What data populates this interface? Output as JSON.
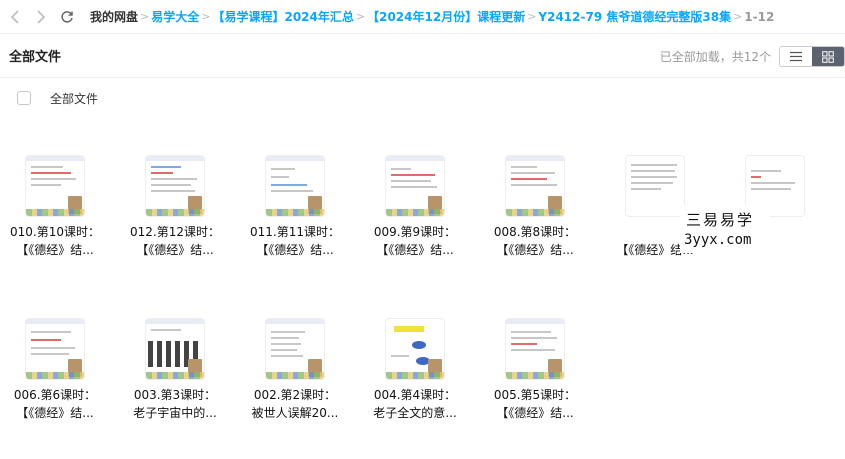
{
  "nav": {
    "back_icon": "chevron-left-icon",
    "forward_icon": "chevron-right-icon",
    "refresh_icon": "refresh-icon"
  },
  "breadcrumb": {
    "items": [
      "我的网盘",
      "易学大全",
      "【易学课程】2024年汇总",
      "【2024年12月份】课程更新",
      "Y2412-79 焦爷道德经完整版38集",
      "1-12"
    ],
    "separator": ">"
  },
  "toolbar": {
    "title": "全部文件",
    "status": "已全部加载，共12个",
    "list_view_icon": "list-view-icon",
    "grid_view_icon": "grid-view-icon"
  },
  "select_row": {
    "label": "全部文件"
  },
  "files": [
    {
      "line1": "010.第10课时：",
      "line2": "【《德经》结..."
    },
    {
      "line1": "012.第12课时：",
      "line2": "【《德经》结..."
    },
    {
      "line1": "011.第11课时：",
      "line2": "【《德经》结..."
    },
    {
      "line1": "009.第9课时：",
      "line2": "【《德经》结..."
    },
    {
      "line1": "008.第8课时：",
      "line2": "【《德经》结..."
    },
    {
      "line1": "",
      "line2": "【《德经》结..."
    },
    {
      "line1": "",
      "line2": ""
    },
    {
      "line1": "006.第6课时：",
      "line2": "【《德经》结..."
    },
    {
      "line1": "003.第3课时：",
      "line2": "老子宇宙中的..."
    },
    {
      "line1": "002.第2课时：",
      "line2": "被世人误解20..."
    },
    {
      "line1": "004.第4课时：",
      "line2": "老子全文的意..."
    },
    {
      "line1": "005.第5课时：",
      "line2": "【《德经》结..."
    }
  ],
  "watermark": {
    "line1": "三易易学",
    "line2": "3yyx.com"
  },
  "colors": {
    "link": "#06a7ff",
    "active_toggle": "#5c6370"
  }
}
